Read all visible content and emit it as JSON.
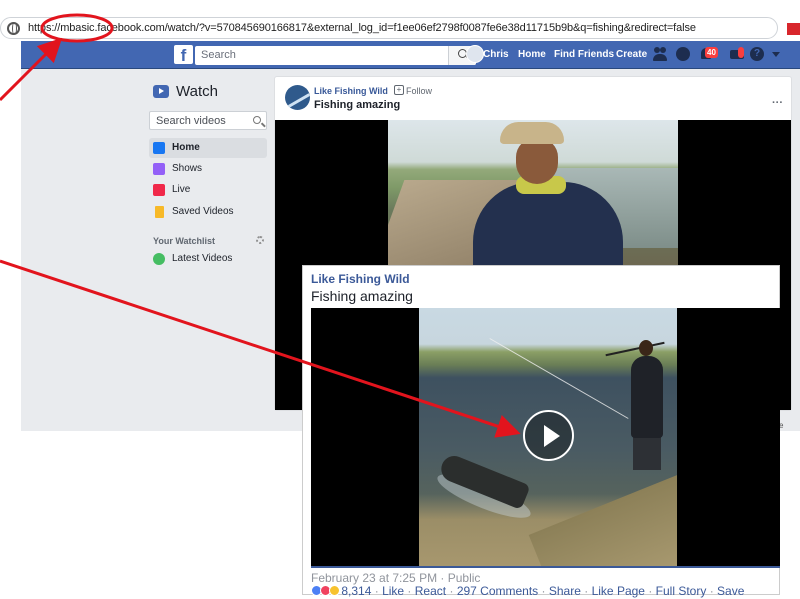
{
  "browser": {
    "url": "https://mbasic.facebook.com/watch/?v=570845690166817&external_log_id=f1ee06ef2798f0087fe6e38d11715b9b&q=fishing&redirect=false"
  },
  "fbnav": {
    "search_placeholder": "Search",
    "user_name": "Chris",
    "home": "Home",
    "find_friends": "Find Friends",
    "create": "Create",
    "notifications_badge": "40",
    "help": "?"
  },
  "sidebar": {
    "title": "Watch",
    "search_placeholder": "Search videos",
    "items": [
      {
        "label": "Home",
        "icon": "home-video-icon",
        "color": "#1877f2"
      },
      {
        "label": "Shows",
        "icon": "shows-icon",
        "color": "#9360f7"
      },
      {
        "label": "Live",
        "icon": "live-icon",
        "color": "#f02849"
      },
      {
        "label": "Saved Videos",
        "icon": "bookmark-icon",
        "color": "#f7b928"
      }
    ],
    "watchlist_heading": "Your Watchlist",
    "watchlist_items": [
      {
        "label": "Latest Videos",
        "icon": "play-circle-icon",
        "color": "#45bd62"
      }
    ]
  },
  "post": {
    "page_name": "Like Fishing Wild",
    "dot": "·",
    "follow": "Follow",
    "title": "Fishing amazing",
    "more": "···"
  },
  "inset": {
    "page_name": "Like Fishing Wild",
    "title": "Fishing amazing",
    "meta": "February 23 at 7:25 PM · Public",
    "reactions_count": "8,314",
    "actions": [
      "Like",
      "React",
      "297 Comments",
      "Share",
      "Like Page",
      "Full Story",
      "Save"
    ]
  },
  "right_edge_text": "e",
  "colors": {
    "fb_blue": "#4267b2",
    "link_blue": "#385898",
    "annotation_red": "#e2141d"
  }
}
